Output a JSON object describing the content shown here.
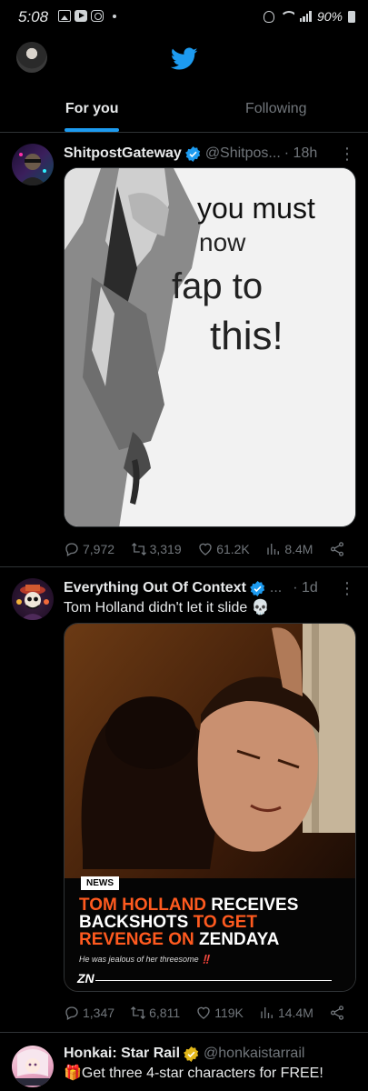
{
  "status_bar": {
    "time": "5:08",
    "battery": "90%"
  },
  "header": {
    "logo": "twitter-bird-icon"
  },
  "tabs": [
    {
      "label": "For you",
      "active": true
    },
    {
      "label": "Following",
      "active": false
    }
  ],
  "colors": {
    "accent": "#1d9bf0",
    "verified_gold": "#e2b719",
    "headline_orange": "#ff5a1f"
  },
  "posts": [
    {
      "name": "ShitpostGateway",
      "handle": "@Shitpos...",
      "time": "· 18h",
      "more": "⋮",
      "text": "",
      "media": {
        "lines": [
          "you must",
          "now",
          "fap to",
          "this!"
        ]
      },
      "replies": "7,972",
      "reposts": "3,319",
      "likes": "61.2K",
      "views": "8.4M"
    },
    {
      "name": "Everything Out Of Context",
      "handle": "...",
      "time": "· 1d",
      "more": "⋮",
      "text": "Tom Holland didn't let it slide 💀",
      "media": {
        "tag": "NEWS",
        "headline_1a": "TOM HOLLAND",
        "headline_1b": " RECEIVES",
        "headline_2a": "BACKSHOTS",
        "headline_2b": " TO GET",
        "headline_3a": "REVENGE ON",
        "headline_3b": " ZENDAYA",
        "subline": "He was jealous of her threesome",
        "subline_mark": "‼️",
        "logo": "ZN"
      },
      "replies": "1,347",
      "reposts": "6,811",
      "likes": "119K",
      "views": "14.4M"
    },
    {
      "name": "Honkai: Star Rail",
      "handle": "@honkaistarrail",
      "time": "",
      "text": "🎁Get three 4-star characters for FREE!"
    }
  ]
}
